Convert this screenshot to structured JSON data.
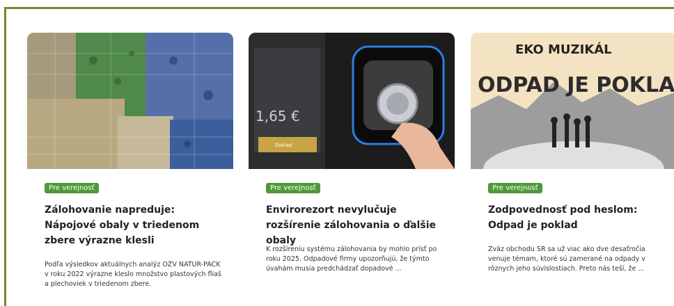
{
  "cards": [
    {
      "category": "Pre verejnosť",
      "title": "Zálohovanie napreduje: Nápojové obaly v triedenom zbere výrazne klesli",
      "excerpt": "Podľa výsledkov aktuálnych analýz OZV NATUR-PACK v roku 2022 výrazne kleslo množstvo plastových fliaš a plechoviek v triedenom zbere."
    },
    {
      "category": "Pre verejnosť",
      "title": "Envirorezort nevylučuje rozšírenie zálohovania o ďalšie obaly",
      "excerpt": "K rozšíreniu systému zálohovania by mohlo prísť po roku 2025. Odpadové firmy upozorňujú, že týmto úvahám musia predchádzať dopadové ...",
      "image_text": {
        "price": "1,65 €",
        "button": "Doklad"
      }
    },
    {
      "category": "Pre verejnosť",
      "title": "Zodpovednosť pod heslom: Odpad je poklad",
      "excerpt": "Zväz obchodu SR sa už viac ako dve desaťročia venuje témam, ktoré sú zamerané na odpady v rôznych jeho súvislostiach. Preto nás teší, že ...",
      "image_text": {
        "line1": "EKO MUZIKÁL",
        "line2": "ODPAD JE POKLAD"
      }
    }
  ],
  "colors": {
    "frame": "#6d8b2e",
    "badge": "#4e9a3b"
  }
}
